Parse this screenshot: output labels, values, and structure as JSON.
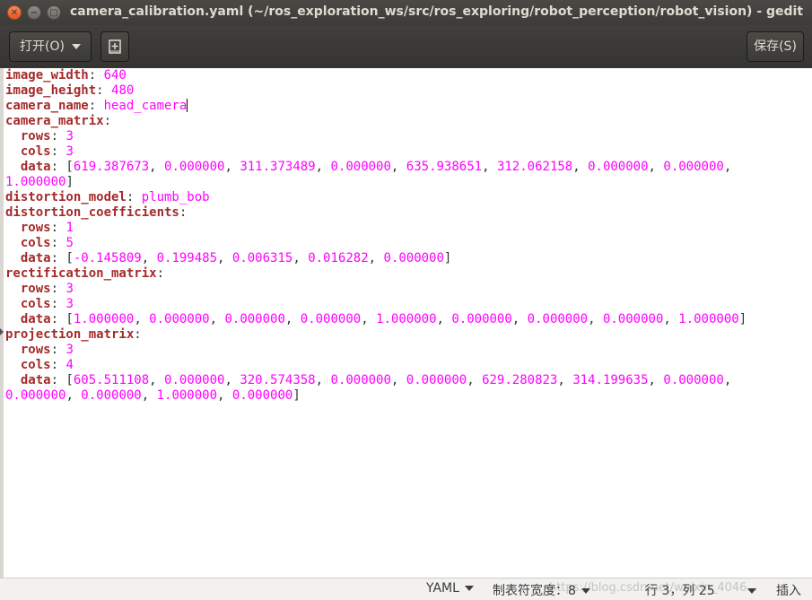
{
  "window": {
    "title": "camera_calibration.yaml (~/ros_exploration_ws/src/ros_exploring/robot_perception/robot_vision) - gedit",
    "close_glyph": "✕",
    "minimize_glyph": "−",
    "maximize_glyph": "□"
  },
  "headerbar": {
    "open_label": "打开(O)",
    "new_tab_icon": "new-document-icon",
    "save_label": "保存(S)"
  },
  "editor": {
    "lines": [
      [
        {
          "t": "k",
          "s": "image_width"
        },
        {
          "t": "p",
          "s": ": "
        },
        {
          "t": "v",
          "s": "640"
        }
      ],
      [
        {
          "t": "k",
          "s": "image_height"
        },
        {
          "t": "p",
          "s": ": "
        },
        {
          "t": "v",
          "s": "480"
        }
      ],
      [
        {
          "t": "k",
          "s": "camera_name"
        },
        {
          "t": "p",
          "s": ": "
        },
        {
          "t": "v",
          "s": "head_camera"
        },
        {
          "t": "cursor",
          "s": ""
        }
      ],
      [
        {
          "t": "k",
          "s": "camera_matrix"
        },
        {
          "t": "p",
          "s": ":"
        }
      ],
      [
        {
          "t": "p",
          "s": "  "
        },
        {
          "t": "k",
          "s": "rows"
        },
        {
          "t": "p",
          "s": ": "
        },
        {
          "t": "v",
          "s": "3"
        }
      ],
      [
        {
          "t": "p",
          "s": "  "
        },
        {
          "t": "k",
          "s": "cols"
        },
        {
          "t": "p",
          "s": ": "
        },
        {
          "t": "v",
          "s": "3"
        }
      ],
      [
        {
          "t": "p",
          "s": "  "
        },
        {
          "t": "k",
          "s": "data"
        },
        {
          "t": "p",
          "s": ": ["
        },
        {
          "t": "v",
          "s": "619.387673"
        },
        {
          "t": "p",
          "s": ", "
        },
        {
          "t": "v",
          "s": "0.000000"
        },
        {
          "t": "p",
          "s": ", "
        },
        {
          "t": "v",
          "s": "311.373489"
        },
        {
          "t": "p",
          "s": ", "
        },
        {
          "t": "v",
          "s": "0.000000"
        },
        {
          "t": "p",
          "s": ", "
        },
        {
          "t": "v",
          "s": "635.938651"
        },
        {
          "t": "p",
          "s": ", "
        },
        {
          "t": "v",
          "s": "312.062158"
        },
        {
          "t": "p",
          "s": ", "
        },
        {
          "t": "v",
          "s": "0.000000"
        },
        {
          "t": "p",
          "s": ", "
        },
        {
          "t": "v",
          "s": "0.000000"
        },
        {
          "t": "p",
          "s": ","
        }
      ],
      [
        {
          "t": "v",
          "s": "1.000000"
        },
        {
          "t": "p",
          "s": "]"
        }
      ],
      [
        {
          "t": "k",
          "s": "distortion_model"
        },
        {
          "t": "p",
          "s": ": "
        },
        {
          "t": "v",
          "s": "plumb_bob"
        }
      ],
      [
        {
          "t": "k",
          "s": "distortion_coefficients"
        },
        {
          "t": "p",
          "s": ":"
        }
      ],
      [
        {
          "t": "p",
          "s": "  "
        },
        {
          "t": "k",
          "s": "rows"
        },
        {
          "t": "p",
          "s": ": "
        },
        {
          "t": "v",
          "s": "1"
        }
      ],
      [
        {
          "t": "p",
          "s": "  "
        },
        {
          "t": "k",
          "s": "cols"
        },
        {
          "t": "p",
          "s": ": "
        },
        {
          "t": "v",
          "s": "5"
        }
      ],
      [
        {
          "t": "p",
          "s": "  "
        },
        {
          "t": "k",
          "s": "data"
        },
        {
          "t": "p",
          "s": ": ["
        },
        {
          "t": "v",
          "s": "-0.145809"
        },
        {
          "t": "p",
          "s": ", "
        },
        {
          "t": "v",
          "s": "0.199485"
        },
        {
          "t": "p",
          "s": ", "
        },
        {
          "t": "v",
          "s": "0.006315"
        },
        {
          "t": "p",
          "s": ", "
        },
        {
          "t": "v",
          "s": "0.016282"
        },
        {
          "t": "p",
          "s": ", "
        },
        {
          "t": "v",
          "s": "0.000000"
        },
        {
          "t": "p",
          "s": "]"
        }
      ],
      [
        {
          "t": "k",
          "s": "rectification_matrix"
        },
        {
          "t": "p",
          "s": ":"
        }
      ],
      [
        {
          "t": "p",
          "s": "  "
        },
        {
          "t": "k",
          "s": "rows"
        },
        {
          "t": "p",
          "s": ": "
        },
        {
          "t": "v",
          "s": "3"
        }
      ],
      [
        {
          "t": "p",
          "s": "  "
        },
        {
          "t": "k",
          "s": "cols"
        },
        {
          "t": "p",
          "s": ": "
        },
        {
          "t": "v",
          "s": "3"
        }
      ],
      [
        {
          "t": "p",
          "s": "  "
        },
        {
          "t": "k",
          "s": "data"
        },
        {
          "t": "p",
          "s": ": ["
        },
        {
          "t": "v",
          "s": "1.000000"
        },
        {
          "t": "p",
          "s": ", "
        },
        {
          "t": "v",
          "s": "0.000000"
        },
        {
          "t": "p",
          "s": ", "
        },
        {
          "t": "v",
          "s": "0.000000"
        },
        {
          "t": "p",
          "s": ", "
        },
        {
          "t": "v",
          "s": "0.000000"
        },
        {
          "t": "p",
          "s": ", "
        },
        {
          "t": "v",
          "s": "1.000000"
        },
        {
          "t": "p",
          "s": ", "
        },
        {
          "t": "v",
          "s": "0.000000"
        },
        {
          "t": "p",
          "s": ", "
        },
        {
          "t": "v",
          "s": "0.000000"
        },
        {
          "t": "p",
          "s": ", "
        },
        {
          "t": "v",
          "s": "0.000000"
        },
        {
          "t": "p",
          "s": ", "
        },
        {
          "t": "v",
          "s": "1.000000"
        },
        {
          "t": "p",
          "s": "]"
        }
      ],
      [
        {
          "t": "k",
          "s": "projection_matrix"
        },
        {
          "t": "p",
          "s": ":"
        }
      ],
      [
        {
          "t": "p",
          "s": "  "
        },
        {
          "t": "k",
          "s": "rows"
        },
        {
          "t": "p",
          "s": ": "
        },
        {
          "t": "v",
          "s": "3"
        }
      ],
      [
        {
          "t": "p",
          "s": "  "
        },
        {
          "t": "k",
          "s": "cols"
        },
        {
          "t": "p",
          "s": ": "
        },
        {
          "t": "v",
          "s": "4"
        }
      ],
      [
        {
          "t": "p",
          "s": "  "
        },
        {
          "t": "k",
          "s": "data"
        },
        {
          "t": "p",
          "s": ": ["
        },
        {
          "t": "v",
          "s": "605.511108"
        },
        {
          "t": "p",
          "s": ", "
        },
        {
          "t": "v",
          "s": "0.000000"
        },
        {
          "t": "p",
          "s": ", "
        },
        {
          "t": "v",
          "s": "320.574358"
        },
        {
          "t": "p",
          "s": ", "
        },
        {
          "t": "v",
          "s": "0.000000"
        },
        {
          "t": "p",
          "s": ", "
        },
        {
          "t": "v",
          "s": "0.000000"
        },
        {
          "t": "p",
          "s": ", "
        },
        {
          "t": "v",
          "s": "629.280823"
        },
        {
          "t": "p",
          "s": ", "
        },
        {
          "t": "v",
          "s": "314.199635"
        },
        {
          "t": "p",
          "s": ", "
        },
        {
          "t": "v",
          "s": "0.000000"
        },
        {
          "t": "p",
          "s": ","
        }
      ],
      [
        {
          "t": "v",
          "s": "0.000000"
        },
        {
          "t": "p",
          "s": ", "
        },
        {
          "t": "v",
          "s": "0.000000"
        },
        {
          "t": "p",
          "s": ", "
        },
        {
          "t": "v",
          "s": "1.000000"
        },
        {
          "t": "p",
          "s": ", "
        },
        {
          "t": "v",
          "s": "0.000000"
        },
        {
          "t": "p",
          "s": "]"
        }
      ]
    ]
  },
  "statusbar": {
    "language": "YAML",
    "tab_width": "制表符宽度：8",
    "position": "行 3，列 25",
    "insert_mode": "插入",
    "watermark": "https://blog.csdn.net/weixin_4046..."
  },
  "colors": {
    "key": "#a52a2a",
    "value": "#ff00ff",
    "titlebar": "#3c3b37"
  }
}
